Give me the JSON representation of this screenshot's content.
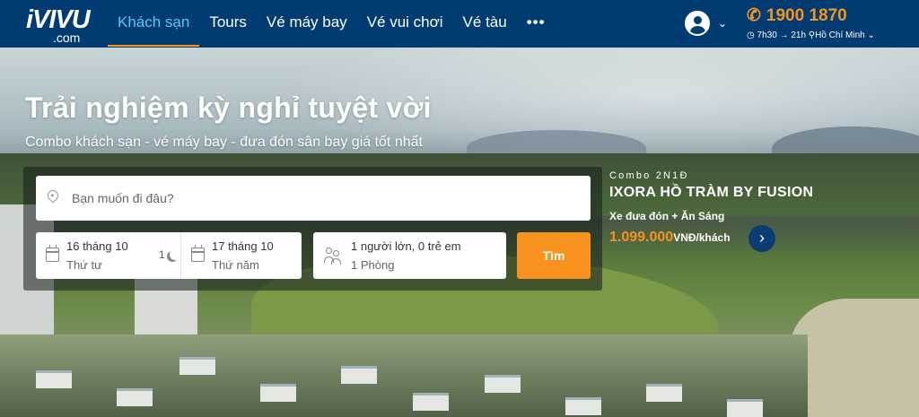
{
  "nav": {
    "logo_top": "iVIVU",
    "logo_bottom": ".com",
    "items": [
      {
        "label": "Khách sạn",
        "active": true
      },
      {
        "label": "Tours"
      },
      {
        "label": "Vé máy bay"
      },
      {
        "label": "Vé vui chơi"
      },
      {
        "label": "Vé tàu"
      },
      {
        "label": "•••"
      }
    ],
    "user_icon": "user-circle-icon",
    "hotline": "1900 1870",
    "hours": "7h30 → 21h",
    "location": "Hồ Chí Minh"
  },
  "hero": {
    "title": "Trải nghiệm kỳ nghỉ tuyệt vời",
    "subtitle": "Combo khách sạn - vé máy bay - đưa đón sân bay giá tốt nhất"
  },
  "search": {
    "destination_placeholder": "Bạn muốn đi đâu?",
    "checkin_date": "16  tháng 10",
    "checkin_day": "Thứ tư",
    "nights": "1",
    "checkout_date": "17  tháng 10",
    "checkout_day": "Thứ năm",
    "guests": "1 người lớn, 0 trẻ em",
    "rooms": "1 Phòng",
    "submit": "Tìm"
  },
  "promo": {
    "kicker": "Combo 2N1Đ",
    "title": "IXORA HỒ TRÀM BY FUSION",
    "sub": "Xe đưa đón + Ăn Sáng",
    "price": "1.099.000",
    "unit": "VNĐ/khách"
  },
  "colors": {
    "nav_bg": "#003c71",
    "accent": "#f7931e",
    "active_link": "#5ac8f5"
  }
}
